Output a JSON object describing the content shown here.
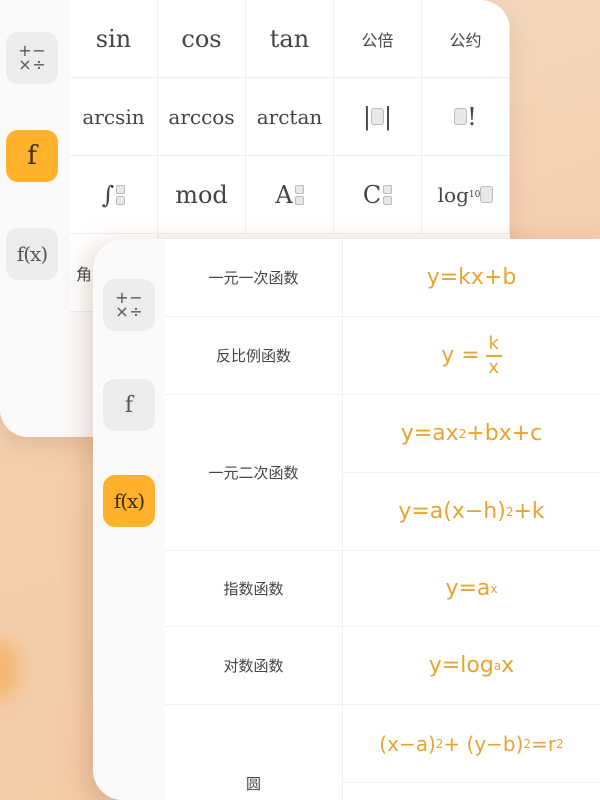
{
  "back_sidebar": {
    "ops_symbols": [
      "+",
      "−",
      "×",
      "÷"
    ],
    "f_label": "f",
    "fx_label": "f(x)"
  },
  "back_grid": {
    "row1": [
      "sin",
      "cos",
      "tan",
      "公倍",
      "公约"
    ],
    "row2": [
      "arcsin",
      "arccos",
      "arctan",
      "|",
      "|",
      "!"
    ],
    "row3": {
      "integral": "∫",
      "mod": "mod",
      "a": "A",
      "c": "C",
      "log": "log",
      "log_base": "10"
    },
    "row4_partial": [
      "角"
    ]
  },
  "front_sidebar": {
    "ops_symbols": [
      "+",
      "−",
      "×",
      "÷"
    ],
    "f_label": "f",
    "fx_label": "f(x)"
  },
  "functions": {
    "linear": {
      "name": "一元一次函数",
      "formula": "y=kx+b"
    },
    "inverse": {
      "name": "反比例函数",
      "lhs": "y = ",
      "num": "k",
      "den": "x"
    },
    "quadratic": {
      "name": "一元二次函数",
      "f1_a": "y=ax",
      "f1_exp": "2",
      "f1_b": "+bx+c",
      "f2_a": "y=a(x−h)",
      "f2_exp": "2",
      "f2_b": "+k"
    },
    "exponential": {
      "name": "指数函数",
      "base": "y=a",
      "exp": "x"
    },
    "logarithmic": {
      "name": "对数函数",
      "pre": "y=log",
      "sub": "a",
      "post": "x"
    },
    "circle": {
      "name": "圆",
      "p1": "(x−a)",
      "e1": "2",
      "p2": " + (y−b)",
      "e2": "2",
      "p3": " =r",
      "e3": "2"
    }
  },
  "colors": {
    "accent": "#ffb12b",
    "formula": "#e8a432",
    "background": "#f3cfae"
  }
}
